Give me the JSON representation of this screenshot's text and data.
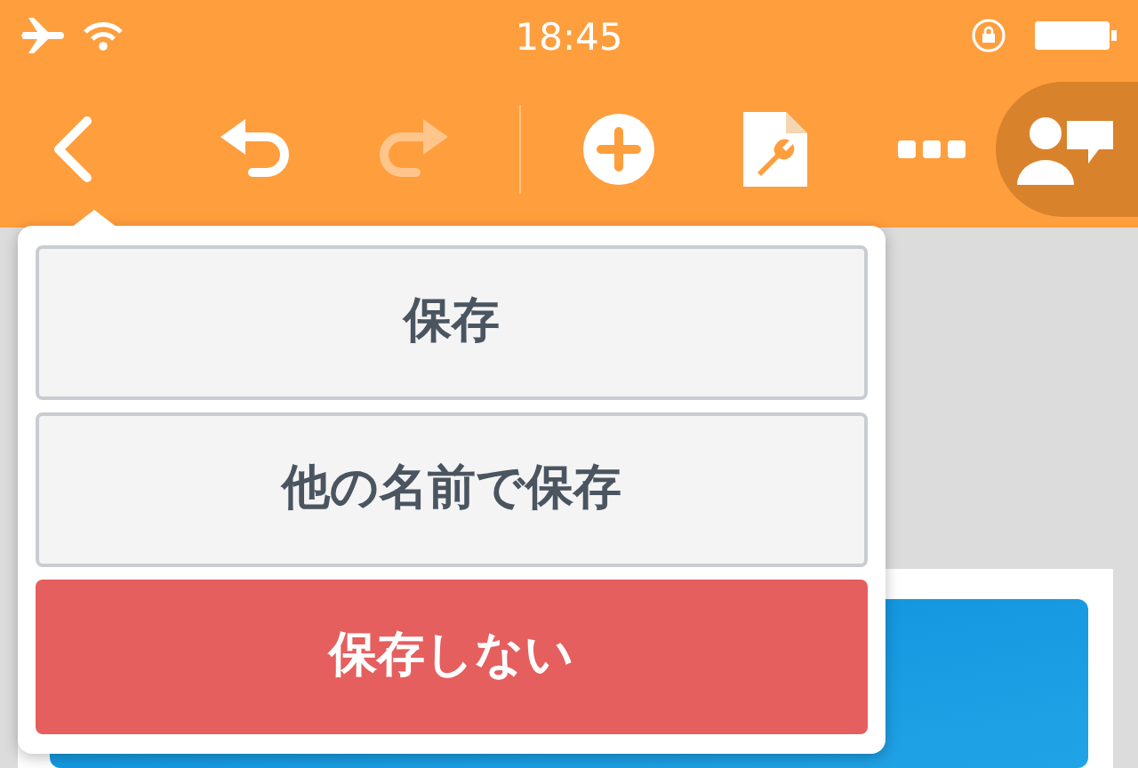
{
  "status_bar": {
    "time": "18:45"
  },
  "toolbar": {
    "items": [
      {
        "kind": "back",
        "disabled": false,
        "selected": false
      },
      {
        "kind": "undo",
        "disabled": false,
        "selected": false
      },
      {
        "kind": "redo",
        "disabled": true,
        "selected": false
      },
      {
        "kind": "add",
        "disabled": false,
        "selected": false
      },
      {
        "kind": "document-tools",
        "disabled": false,
        "selected": false
      },
      {
        "kind": "more",
        "disabled": false,
        "selected": false
      },
      {
        "kind": "collaborate",
        "disabled": false,
        "selected": true
      }
    ]
  },
  "popover": {
    "buttons": [
      {
        "label": "保存",
        "kind": "normal"
      },
      {
        "label": "他の名前で保存",
        "kind": "normal"
      },
      {
        "label": "保存しない",
        "kind": "destructive"
      }
    ]
  }
}
